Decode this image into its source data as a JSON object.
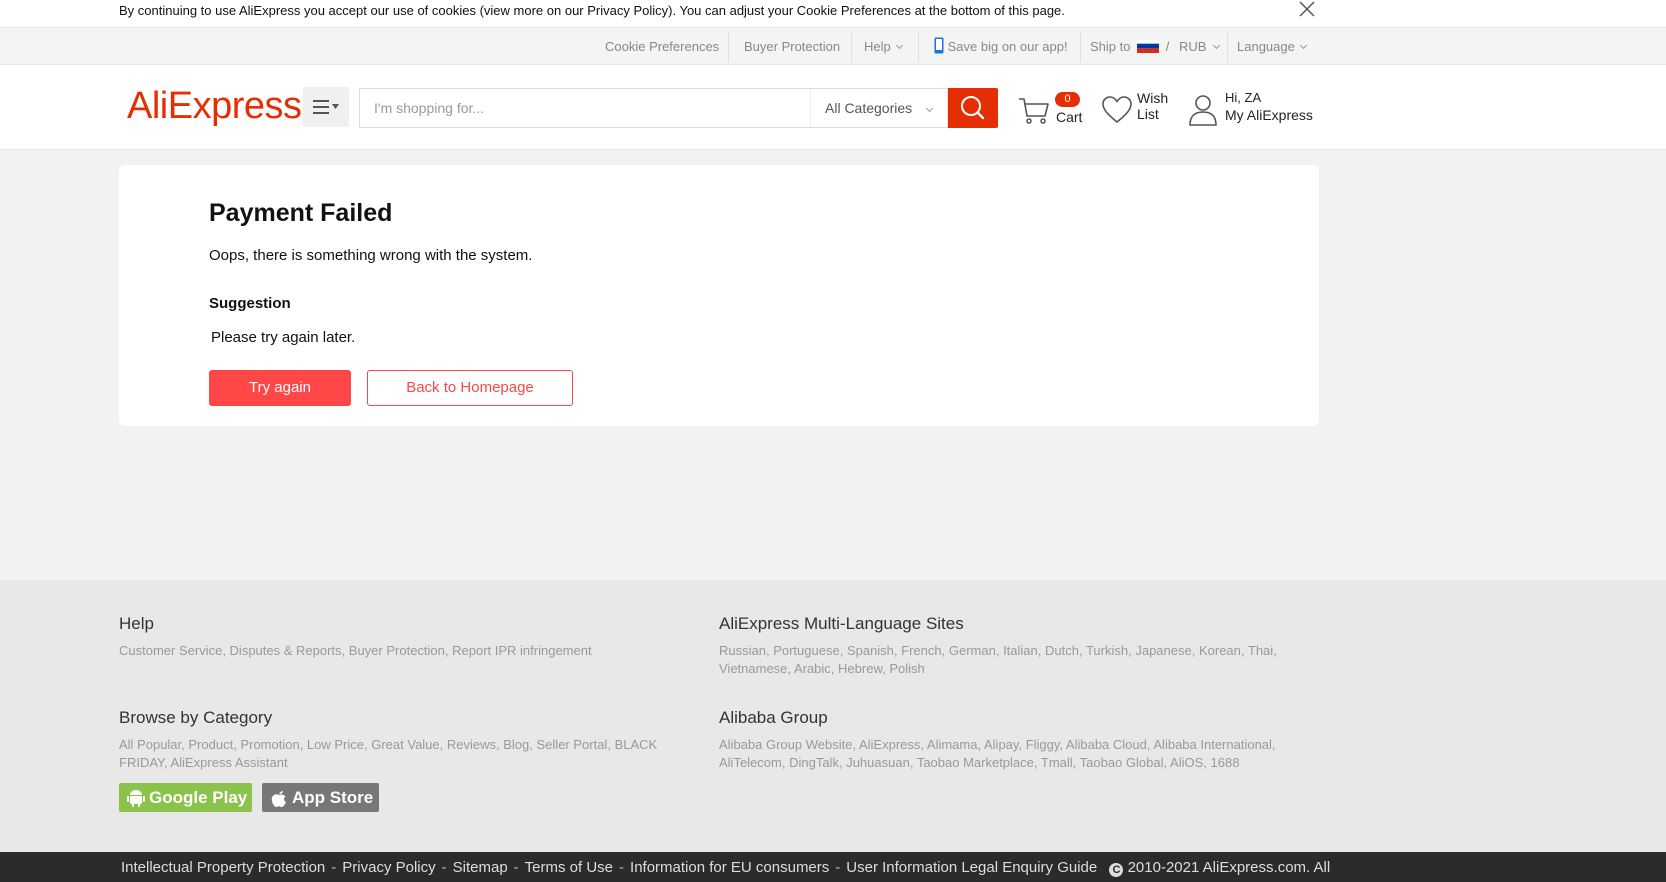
{
  "cookie_bar": {
    "text": "By continuing to use AliExpress you accept our use of cookies (view more on our Privacy Policy). You can adjust your Cookie Preferences at the bottom of this page."
  },
  "topnav": {
    "cookie_preferences": "Cookie Preferences",
    "buyer_protection": "Buyer Protection",
    "help": "Help",
    "app": "Save big on our app!",
    "ship_to": "Ship to",
    "currency_sep": "/",
    "currency": "RUB",
    "language": "Language"
  },
  "header": {
    "logo": "AliExpress",
    "search_placeholder": "I'm shopping for...",
    "category": "All Categories",
    "cart_count": "0",
    "cart_label": "Cart",
    "wish_label": "Wish List",
    "account_hi": "Hi, ZA",
    "account_my": "My AliExpress"
  },
  "main": {
    "title": "Payment Failed",
    "message": "Oops, there is something wrong with the system.",
    "suggestion_title": "Suggestion",
    "suggestion_text": "Please try again later.",
    "try_again": "Try again",
    "back_home": "Back to Homepage"
  },
  "footer": {
    "help_title": "Help",
    "help_links": [
      "Customer Service",
      "Disputes & Reports",
      "Buyer Protection",
      "Report IPR infringement"
    ],
    "multi_title": "AliExpress Multi-Language Sites",
    "multi_links": [
      "Russian",
      "Portuguese",
      "Spanish",
      "French",
      "German",
      "Italian",
      "Dutch",
      "Turkish",
      "Japanese",
      "Korean",
      "Thai",
      "Vietnamese",
      "Arabic",
      "Hebrew",
      "Polish"
    ],
    "browse_title": "Browse by Category",
    "browse_links": [
      "All Popular",
      "Product",
      "Promotion",
      "Low Price",
      "Great Value",
      "Reviews",
      "Blog",
      "Seller Portal",
      "BLACK FRIDAY",
      "AliExpress Assistant"
    ],
    "alibaba_title": "Alibaba Group",
    "alibaba_links": [
      "Alibaba Group Website",
      "AliExpress",
      "Alimama",
      "Alipay",
      "Fliggy",
      "Alibaba Cloud",
      "Alibaba International",
      "AliTelecom",
      "DingTalk",
      "Juhuasuan",
      "Taobao Marketplace",
      "Tmall",
      "Taobao Global",
      "AliOS",
      "1688"
    ],
    "google_play": "Google Play",
    "app_store": "App Store"
  },
  "bottom_bar": {
    "links": [
      "Intellectual Property Protection",
      "Privacy Policy",
      "Sitemap",
      "Terms of Use",
      "Information for EU consumers",
      "User Information Legal Enquiry Guide"
    ],
    "copyright": "2010-2021 AliExpress.com. All"
  },
  "colors": {
    "brand": "#e62e04",
    "button": "#ff4747",
    "google_play": "#8bc34a",
    "app_store": "#777777"
  }
}
